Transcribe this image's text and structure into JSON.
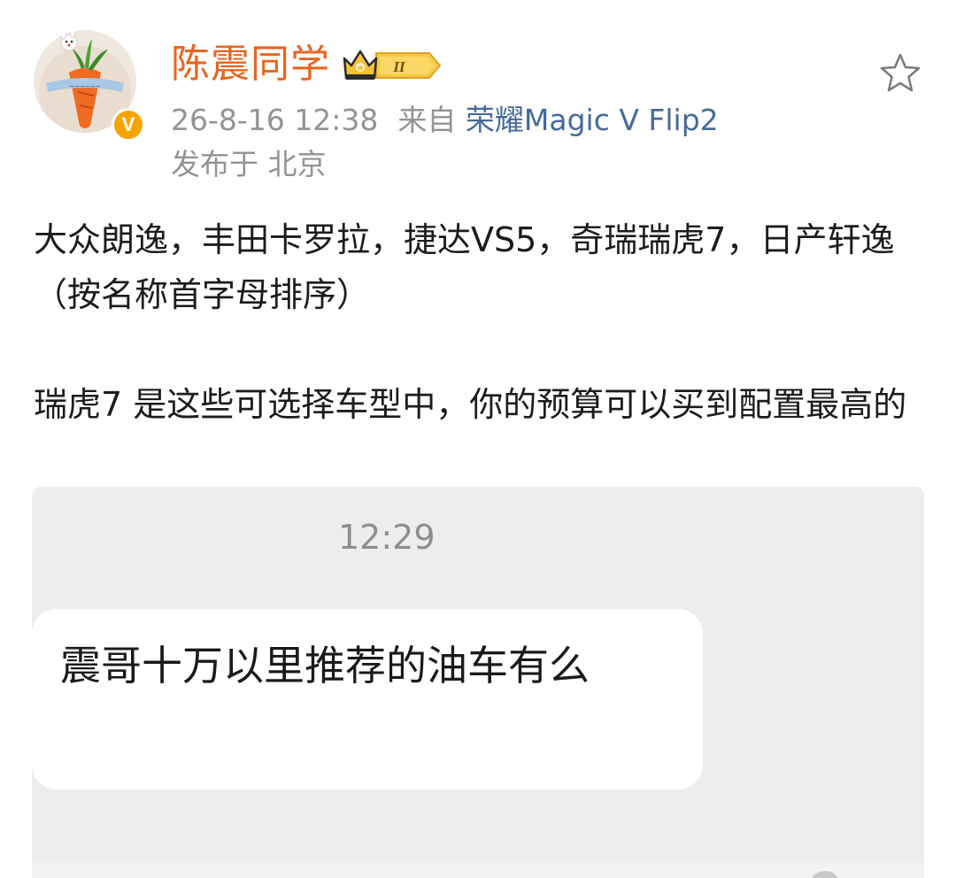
{
  "user": {
    "name": "陈震同学",
    "badge_level": "II"
  },
  "meta": {
    "timestamp": "26-8-16 12:38",
    "source_prefix": "来自",
    "device": "荣耀Magic V Flip2",
    "location": "发布于 北京"
  },
  "post": {
    "paragraph_1": "大众朗逸，丰田卡罗拉，捷达VS5，奇瑞瑞虎7，日产轩逸 （按名称首字母排序）",
    "paragraph_2": "瑞虎7 是这些可选择车型中，你的预算可以买到配置最高的"
  },
  "embedded_image": {
    "time": "12:29",
    "message": "震哥十万以里推荐的油车有么"
  },
  "colors": {
    "username": "#e8651e",
    "device_link": "#456a9a",
    "meta_gray": "#939393",
    "verified_badge": "#f7a400",
    "chat_bg": "#ededed"
  },
  "icons": {
    "avatar": "carrot-avatar",
    "verified": "verified-v-icon",
    "crown": "crown-badge-icon",
    "favorite": "star-outline-icon"
  }
}
